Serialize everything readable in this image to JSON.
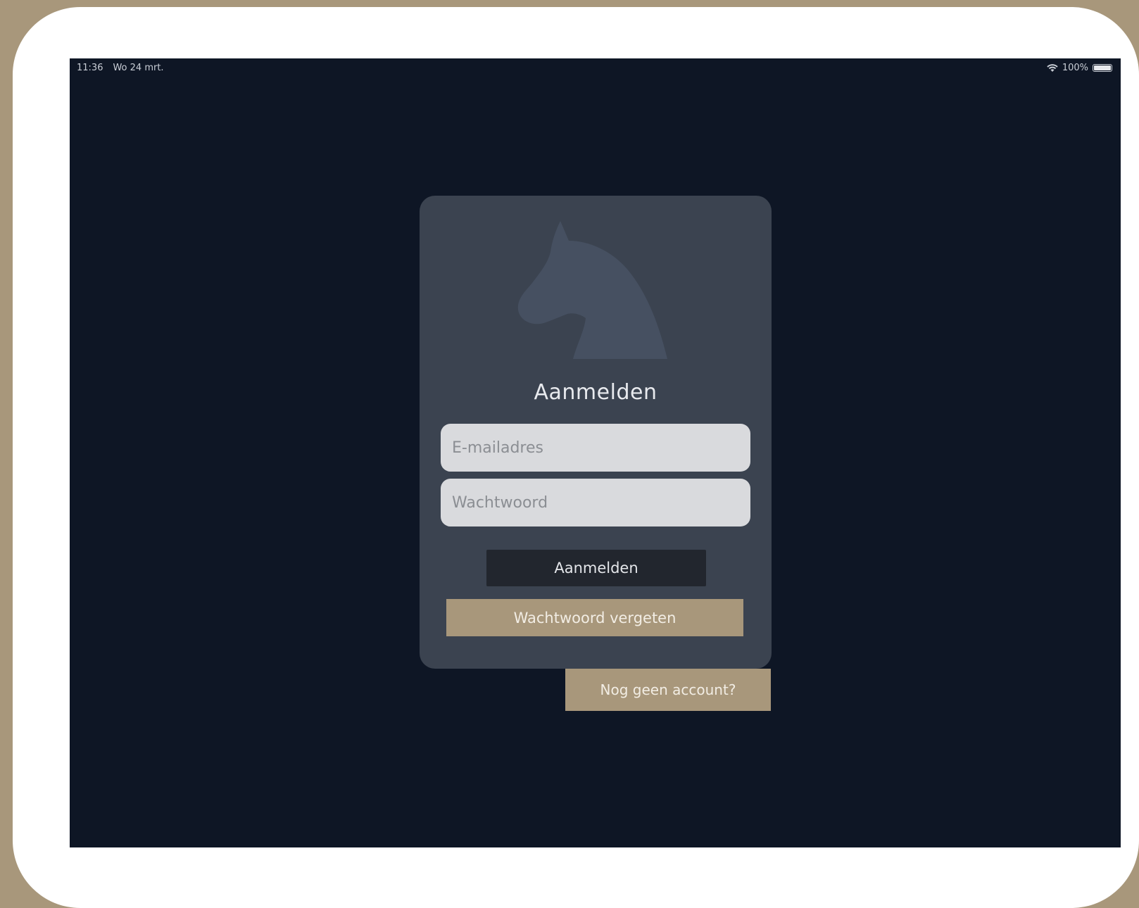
{
  "status_bar": {
    "time": "11:36",
    "date": "Wo 24 mrt.",
    "battery": "100%",
    "wifi_icon": "wifi-icon",
    "battery_icon": "battery-icon"
  },
  "login": {
    "logo_icon": "horse-head-icon",
    "title": "Aanmelden",
    "email": {
      "placeholder": "E-mailadres",
      "value": ""
    },
    "password": {
      "placeholder": "Wachtwoord",
      "value": ""
    },
    "login_button": "Aanmelden",
    "forgot_button": "Wachtwoord vergeten",
    "register_button": "Nog geen account?"
  },
  "colors": {
    "background": "#0e1625",
    "card": "#3b4350",
    "accent": "#a8977b",
    "button_dark": "#22262e",
    "input": "#d9dadd"
  }
}
